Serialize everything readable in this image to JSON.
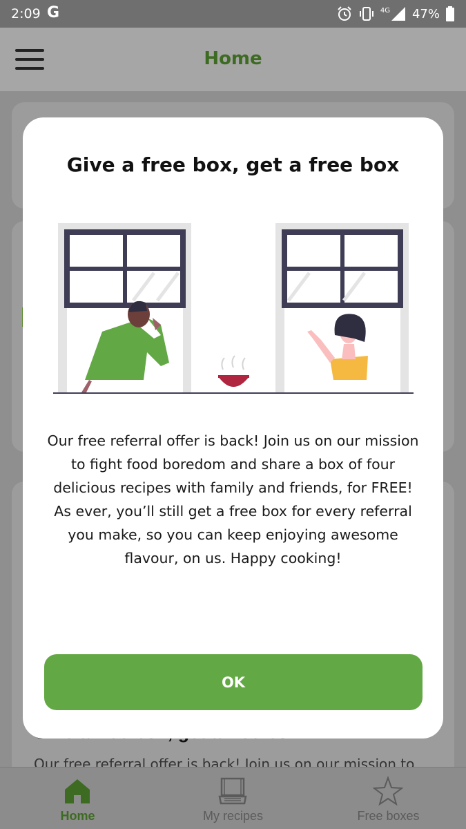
{
  "status_bar": {
    "time": "2:09",
    "google_letter": "G",
    "network": "4G",
    "battery_percent": "47%"
  },
  "app_bar": {
    "title": "Home",
    "menu_icon": "hamburger-menu-icon"
  },
  "background_card": {
    "heading": "Give a free box, get a free box",
    "text": "Our free referral offer is back! Join us on our mission to"
  },
  "modal": {
    "title": "Give a free box, get a free box",
    "body": "Our free referral offer is back! Join us on our mission to fight food boredom and share a box of four delicious recipes with family and friends, for FREE! As ever, you’ll still get a free box for every referral you make, so you can keep enjoying awesome flavour, on us. Happy cooking!",
    "ok_label": "OK"
  },
  "bottom_nav": {
    "items": [
      {
        "label": "Home",
        "icon": "home-icon",
        "active": true
      },
      {
        "label": "My recipes",
        "icon": "recipe-box-icon",
        "active": false
      },
      {
        "label": "Free boxes",
        "icon": "star-icon",
        "active": false
      }
    ]
  },
  "colors": {
    "brand_green": "#62a844",
    "title_green": "#3d6b22"
  }
}
